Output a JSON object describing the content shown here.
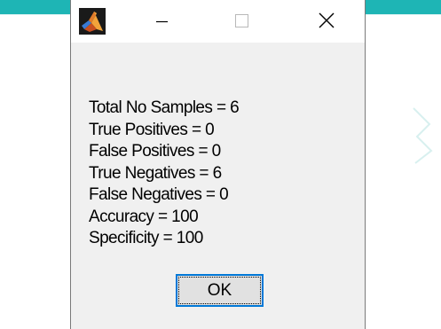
{
  "background": {
    "accent_color": "#1eb5b5"
  },
  "dialog": {
    "title": "",
    "icon": "matlab-icon",
    "controls": {
      "minimize": "minimize-icon",
      "maximize": "maximize-icon",
      "close": "close-icon"
    },
    "message_lines": [
      "Total No Samples = 6",
      "True Positives = 0",
      "False Positives = 0",
      "True Negatives = 6",
      "False Negatives = 0",
      "Accuracy = 100",
      "Specificity = 100"
    ],
    "ok_label": "OK",
    "focus_color": "#0078d7"
  }
}
